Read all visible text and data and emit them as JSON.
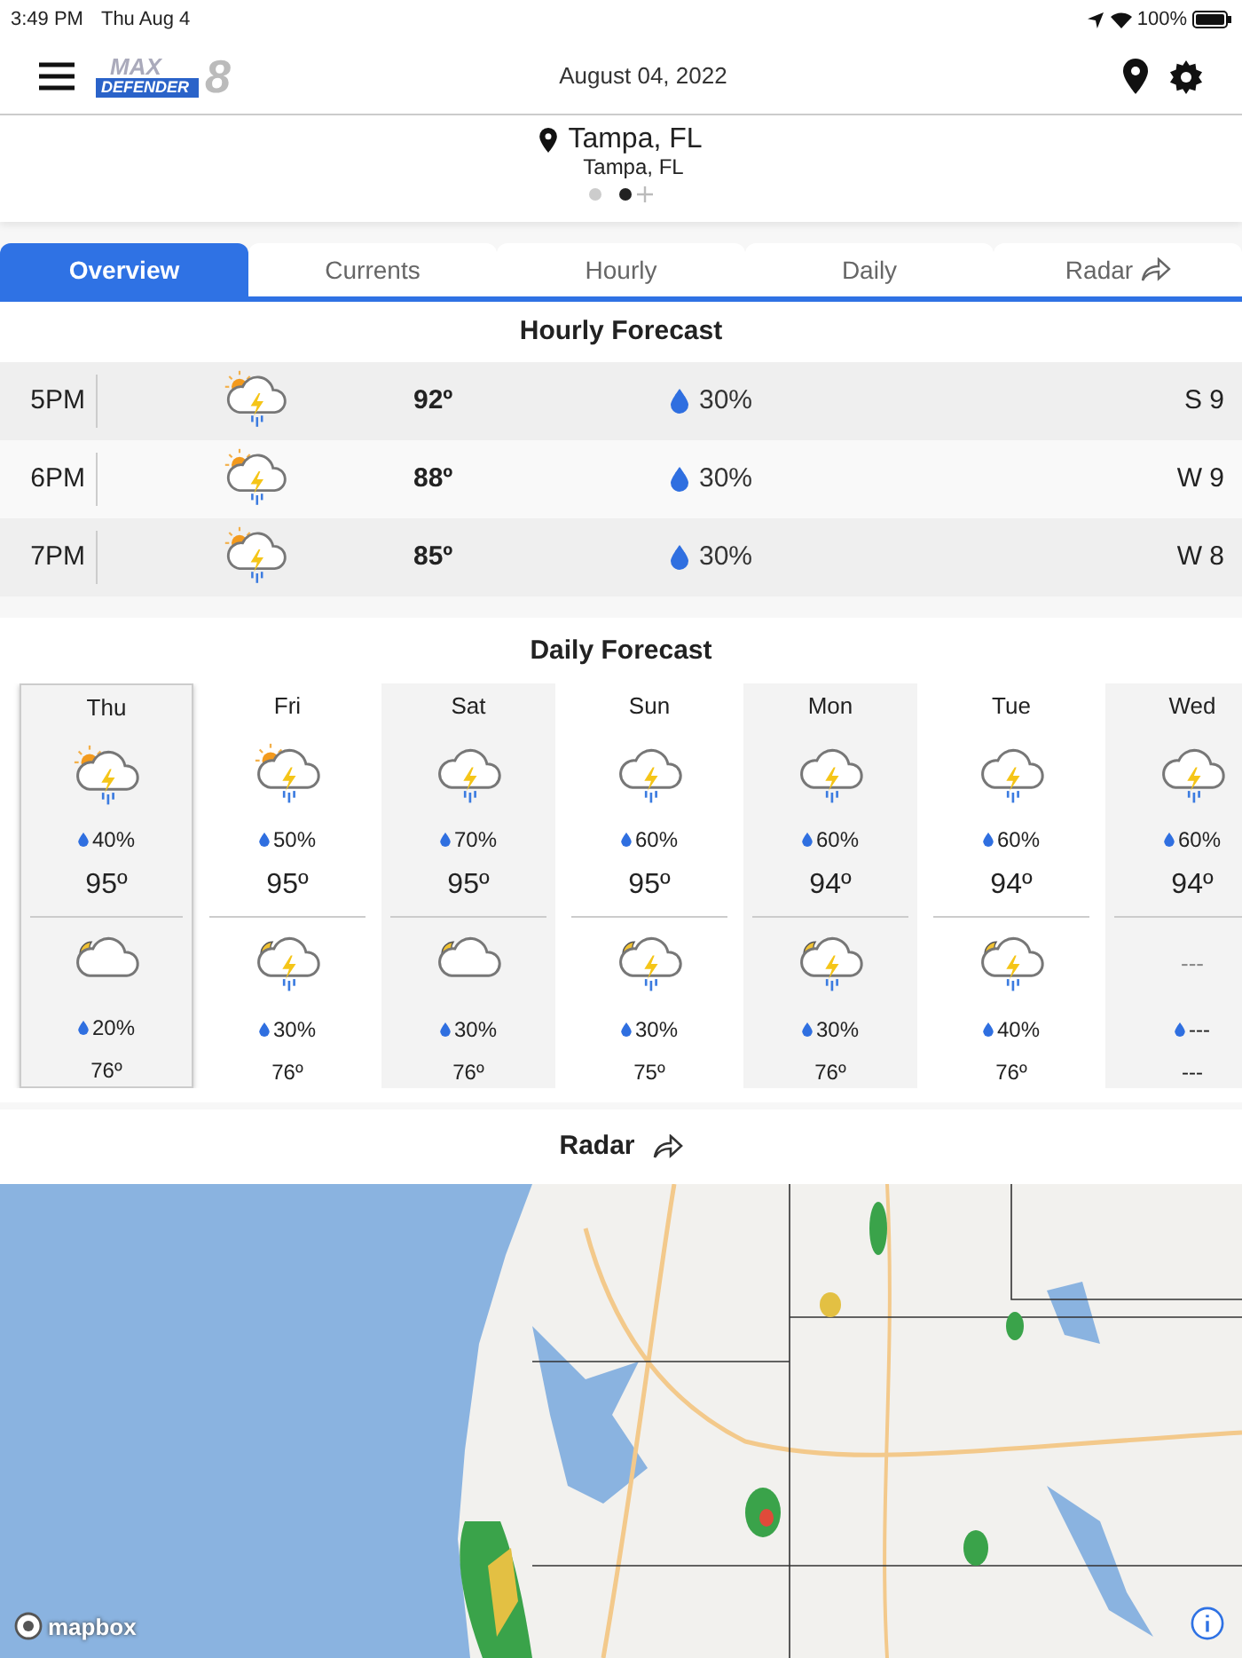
{
  "status_bar": {
    "time": "3:49 PM",
    "date": "Thu Aug 4",
    "battery": "100%"
  },
  "header": {
    "logo": {
      "top": "MAX",
      "bottom": "DEFENDER",
      "badge": "8"
    },
    "date": "August 04, 2022"
  },
  "location": {
    "name": "Tampa, FL",
    "subtitle": "Tampa, FL",
    "pages": [
      {
        "selected": false
      },
      {
        "selected": true
      }
    ]
  },
  "tabs": [
    {
      "label": "Overview",
      "selected": true,
      "share": false
    },
    {
      "label": "Currents",
      "selected": false,
      "share": false
    },
    {
      "label": "Hourly",
      "selected": false,
      "share": false
    },
    {
      "label": "Daily",
      "selected": false,
      "share": false
    },
    {
      "label": "Radar",
      "selected": false,
      "share": true
    }
  ],
  "hourly": {
    "title": "Hourly Forecast",
    "rows": [
      {
        "time": "5PM",
        "kind": "sun-storm",
        "temp": "92º",
        "precip": "30%",
        "wind": "S 9"
      },
      {
        "time": "6PM",
        "kind": "sun-storm",
        "temp": "88º",
        "precip": "30%",
        "wind": "W 9"
      },
      {
        "time": "7PM",
        "kind": "sun-storm",
        "temp": "85º",
        "precip": "30%",
        "wind": "W 8"
      }
    ]
  },
  "daily": {
    "title": "Daily Forecast",
    "days": [
      {
        "day": "Thu",
        "selected": true,
        "day_part": {
          "kind": "sun-storm",
          "precip": "40%",
          "temp": "95º"
        },
        "night_part": {
          "kind": "moon-cloud",
          "precip": "20%",
          "temp": "76º"
        }
      },
      {
        "day": "Fri",
        "selected": false,
        "day_part": {
          "kind": "sun-storm",
          "precip": "50%",
          "temp": "95º"
        },
        "night_part": {
          "kind": "moon-storm",
          "precip": "30%",
          "temp": "76º"
        }
      },
      {
        "day": "Sat",
        "selected": false,
        "day_part": {
          "kind": "storm",
          "precip": "70%",
          "temp": "95º"
        },
        "night_part": {
          "kind": "moon-cloud",
          "precip": "30%",
          "temp": "76º"
        }
      },
      {
        "day": "Sun",
        "selected": false,
        "day_part": {
          "kind": "storm",
          "precip": "60%",
          "temp": "95º"
        },
        "night_part": {
          "kind": "moon-storm",
          "precip": "30%",
          "temp": "75º"
        }
      },
      {
        "day": "Mon",
        "selected": false,
        "day_part": {
          "kind": "storm",
          "precip": "60%",
          "temp": "94º"
        },
        "night_part": {
          "kind": "moon-storm",
          "precip": "30%",
          "temp": "76º"
        }
      },
      {
        "day": "Tue",
        "selected": false,
        "day_part": {
          "kind": "storm",
          "precip": "60%",
          "temp": "94º"
        },
        "night_part": {
          "kind": "moon-storm",
          "precip": "40%",
          "temp": "76º"
        }
      },
      {
        "day": "Wed",
        "selected": false,
        "day_part": {
          "kind": "storm",
          "precip": "60%",
          "temp": "94º"
        },
        "night_part": {
          "kind": "missing",
          "icon_text": "---",
          "precip": "---",
          "temp": "---"
        }
      }
    ]
  },
  "radar": {
    "title": "Radar",
    "attribution": "mapbox"
  }
}
